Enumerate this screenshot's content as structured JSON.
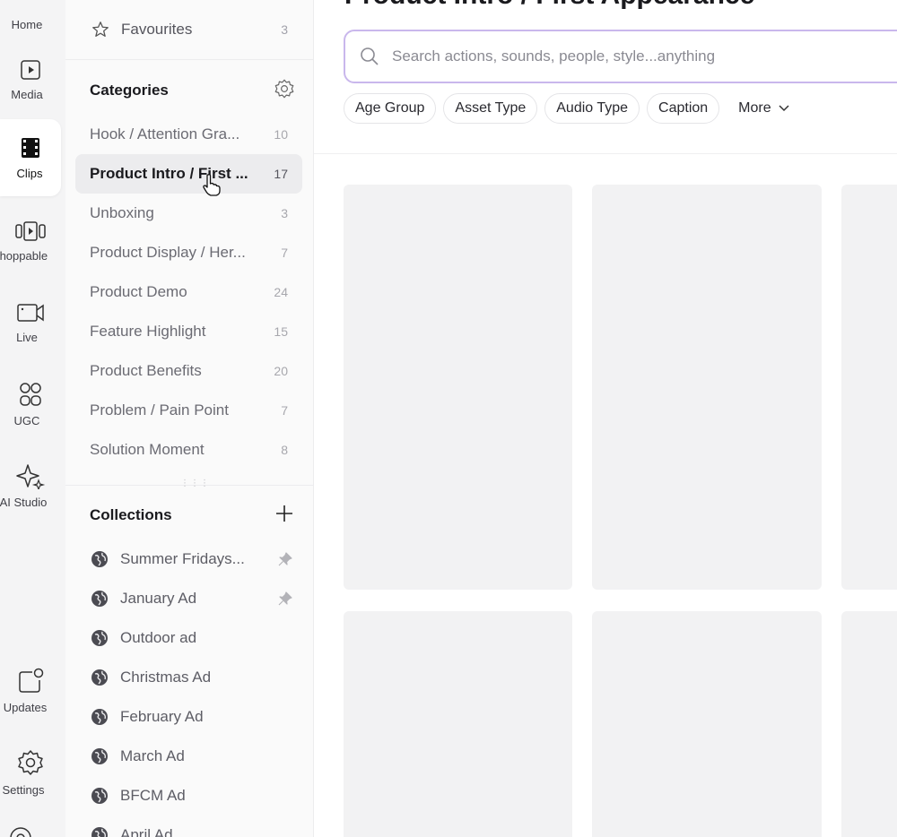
{
  "page_title": "Product Intro / First Appearance",
  "rail": [
    {
      "label": "Home",
      "icon": "home-icon"
    },
    {
      "label": "Media",
      "icon": "media-icon"
    },
    {
      "label": "Clips",
      "icon": "clips-icon",
      "active": true
    },
    {
      "label": "Shoppable",
      "icon": "shoppable-icon"
    },
    {
      "label": "Live",
      "icon": "live-icon"
    },
    {
      "label": "UGC",
      "icon": "ugc-icon"
    },
    {
      "label": "AI Studio",
      "icon": "ai-studio-icon"
    },
    {
      "label": "Updates",
      "icon": "updates-icon"
    },
    {
      "label": "Settings",
      "icon": "settings-icon"
    }
  ],
  "sidebar": {
    "favourites": {
      "label": "Favourites",
      "count": "3"
    },
    "categories_title": "Categories",
    "categories": [
      {
        "name": "Hook / Attention Gra...",
        "count": "10"
      },
      {
        "name": "Product Intro / First ...",
        "count": "17",
        "active": true
      },
      {
        "name": "Unboxing",
        "count": "3"
      },
      {
        "name": "Product Display / Her...",
        "count": "7"
      },
      {
        "name": "Product Demo",
        "count": "24"
      },
      {
        "name": "Feature Highlight",
        "count": "15"
      },
      {
        "name": "Product Benefits",
        "count": "20"
      },
      {
        "name": "Problem / Pain Point",
        "count": "7"
      },
      {
        "name": "Solution Moment",
        "count": "8"
      }
    ],
    "collections_title": "Collections",
    "collections": [
      {
        "name": "Summer Fridays...",
        "pinned": true
      },
      {
        "name": "January Ad",
        "pinned": true
      },
      {
        "name": "Outdoor ad",
        "pinned": false
      },
      {
        "name": "Christmas Ad",
        "pinned": false
      },
      {
        "name": "February Ad",
        "pinned": false
      },
      {
        "name": "March Ad",
        "pinned": false
      },
      {
        "name": "BFCM Ad",
        "pinned": false
      },
      {
        "name": "April Ad",
        "pinned": false
      }
    ]
  },
  "search": {
    "placeholder": "Search actions, sounds, people, style...anything",
    "value": ""
  },
  "filters": [
    "Age Group",
    "Asset Type",
    "Audio Type",
    "Caption"
  ],
  "more_label": "More",
  "colors": {
    "accent_border": "#c9b7ec",
    "placeholder_card": "#f2f2f3",
    "active_item_bg": "#ececee"
  }
}
